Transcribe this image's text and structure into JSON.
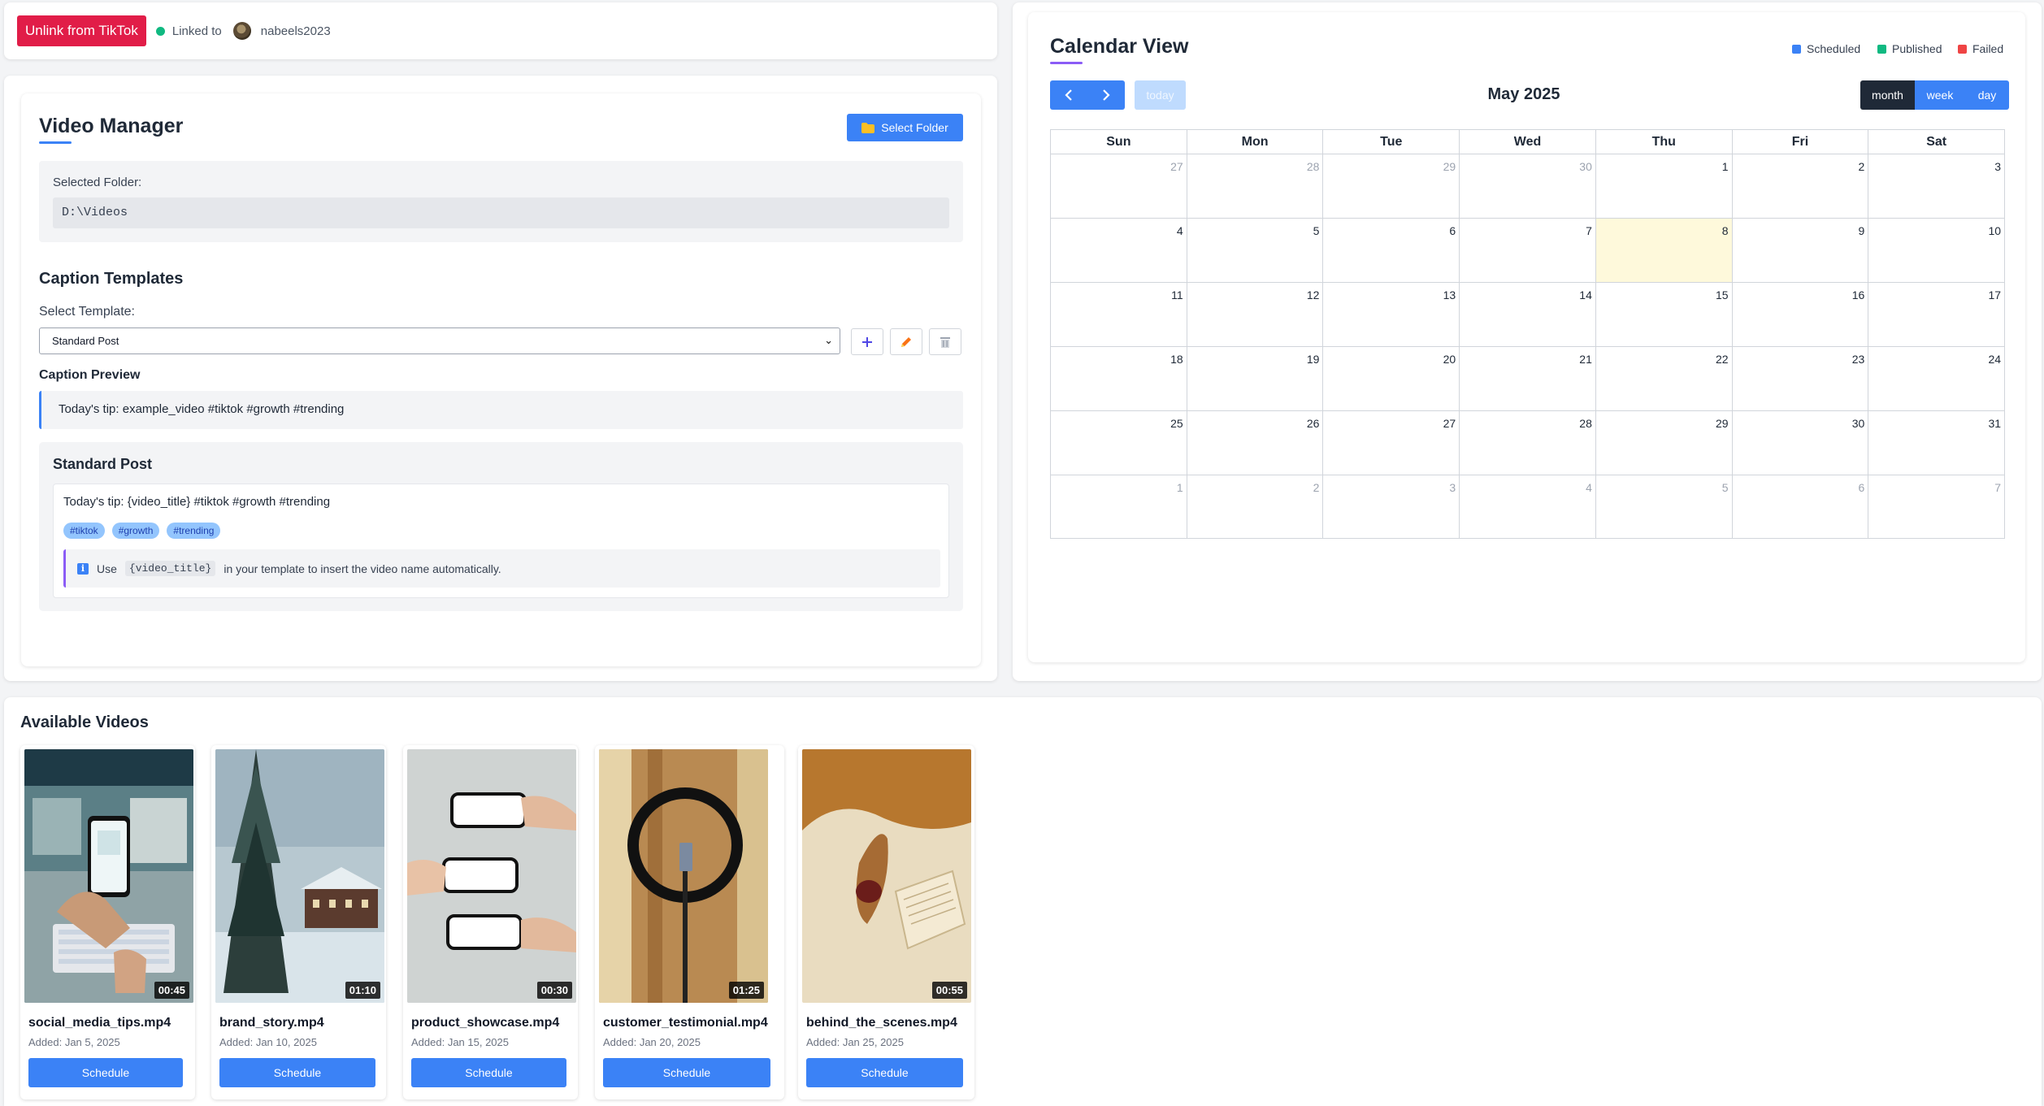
{
  "auth": {
    "unlink_label": "Unlink from TikTok",
    "linked_label": "Linked to",
    "username": "nabeels2023"
  },
  "video_manager": {
    "title": "Video Manager",
    "select_folder_label": "Select Folder",
    "selected_folder_label": "Selected Folder:",
    "folder_path": "D:\\Videos"
  },
  "caption_templates": {
    "title": "Caption Templates",
    "select_label": "Select Template:",
    "selected_template": "Standard Post",
    "preview_title": "Caption Preview",
    "preview_text": "Today's tip: example_video #tiktok #growth #trending",
    "template_name": "Standard Post",
    "template_text": "Today's tip: {video_title} #tiktok #growth #trending",
    "tags": [
      "#tiktok",
      "#growth",
      "#trending"
    ],
    "tip_use": "Use",
    "tip_code": "{video_title}",
    "tip_rest": "in your template to insert the video name automatically."
  },
  "calendar": {
    "title": "Calendar View",
    "legend": [
      {
        "label": "Scheduled",
        "color": "#3b82f6"
      },
      {
        "label": "Published",
        "color": "#10b981"
      },
      {
        "label": "Failed",
        "color": "#ef4444"
      }
    ],
    "today_label": "today",
    "month_title": "May 2025",
    "views": [
      "month",
      "week",
      "day"
    ],
    "active_view": "month",
    "weekdays": [
      "Sun",
      "Mon",
      "Tue",
      "Wed",
      "Thu",
      "Fri",
      "Sat"
    ],
    "weeks": [
      [
        {
          "d": "27",
          "o": true
        },
        {
          "d": "28",
          "o": true
        },
        {
          "d": "29",
          "o": true
        },
        {
          "d": "30",
          "o": true
        },
        {
          "d": "1"
        },
        {
          "d": "2"
        },
        {
          "d": "3"
        }
      ],
      [
        {
          "d": "4"
        },
        {
          "d": "5"
        },
        {
          "d": "6"
        },
        {
          "d": "7"
        },
        {
          "d": "8",
          "today": true
        },
        {
          "d": "9"
        },
        {
          "d": "10"
        }
      ],
      [
        {
          "d": "11"
        },
        {
          "d": "12"
        },
        {
          "d": "13"
        },
        {
          "d": "14"
        },
        {
          "d": "15"
        },
        {
          "d": "16"
        },
        {
          "d": "17"
        }
      ],
      [
        {
          "d": "18"
        },
        {
          "d": "19"
        },
        {
          "d": "20"
        },
        {
          "d": "21"
        },
        {
          "d": "22"
        },
        {
          "d": "23"
        },
        {
          "d": "24"
        }
      ],
      [
        {
          "d": "25"
        },
        {
          "d": "26"
        },
        {
          "d": "27"
        },
        {
          "d": "28"
        },
        {
          "d": "29"
        },
        {
          "d": "30"
        },
        {
          "d": "31"
        }
      ],
      [
        {
          "d": "1",
          "o": true
        },
        {
          "d": "2",
          "o": true
        },
        {
          "d": "3",
          "o": true
        },
        {
          "d": "4",
          "o": true
        },
        {
          "d": "5",
          "o": true
        },
        {
          "d": "6",
          "o": true
        },
        {
          "d": "7",
          "o": true
        }
      ]
    ]
  },
  "videos": {
    "title": "Available Videos",
    "schedule_label": "Schedule",
    "items": [
      {
        "name": "social_media_tips.mp4",
        "added": "Added: Jan 5, 2025",
        "duration": "00:45"
      },
      {
        "name": "brand_story.mp4",
        "added": "Added: Jan 10, 2025",
        "duration": "01:10"
      },
      {
        "name": "product_showcase.mp4",
        "added": "Added: Jan 15, 2025",
        "duration": "00:30"
      },
      {
        "name": "customer_testimonial.mp4",
        "added": "Added: Jan 20, 2025",
        "duration": "01:25"
      },
      {
        "name": "behind_the_scenes.mp4",
        "added": "Added: Jan 25, 2025",
        "duration": "00:55"
      }
    ]
  }
}
